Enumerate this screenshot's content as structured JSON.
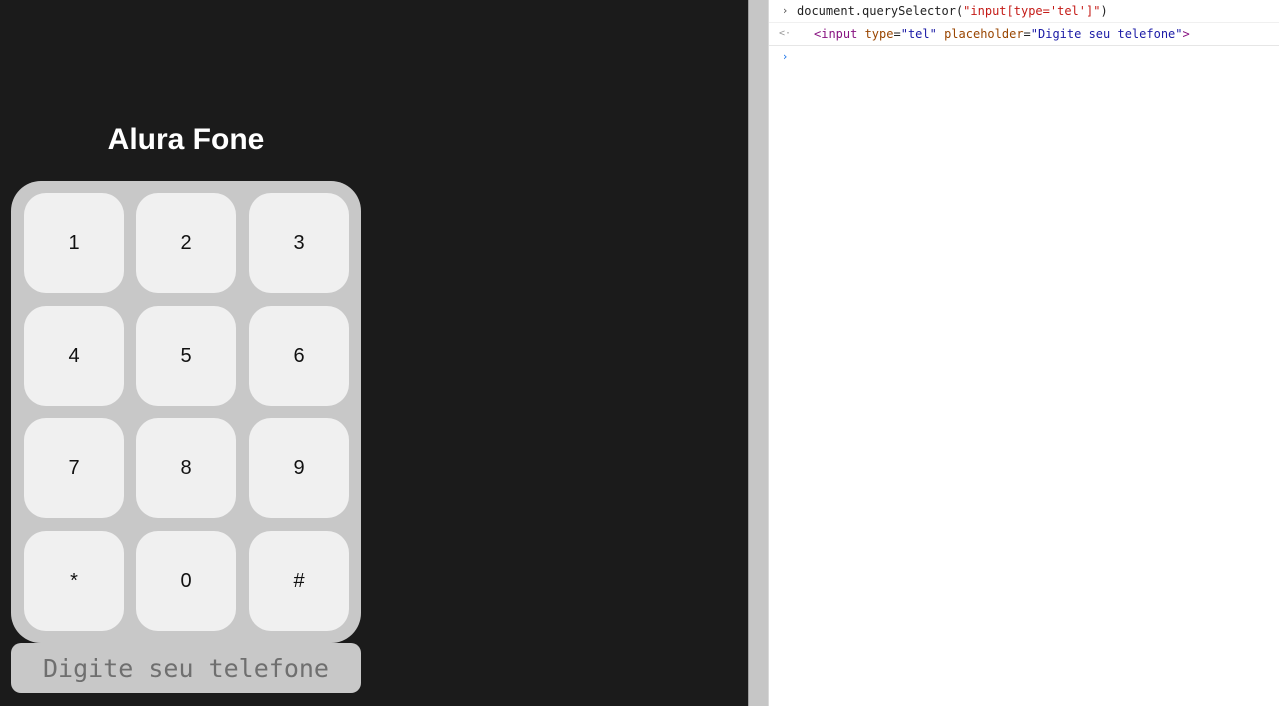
{
  "app": {
    "title": "Alura Fone",
    "keys": [
      {
        "label": "1"
      },
      {
        "label": "2"
      },
      {
        "label": "3"
      },
      {
        "label": "4"
      },
      {
        "label": "5"
      },
      {
        "label": "6"
      },
      {
        "label": "7"
      },
      {
        "label": "8"
      },
      {
        "label": "9"
      },
      {
        "label": "*"
      },
      {
        "label": "0"
      },
      {
        "label": "#"
      }
    ],
    "input": {
      "value": "",
      "placeholder": "Digite seu telefone"
    }
  },
  "console": {
    "command": {
      "prefix": "document.querySelector(",
      "arg": "\"input[type='tel']\"",
      "suffix": ")"
    },
    "result": {
      "open": "<input",
      "attr1_name": " type",
      "eq1": "=",
      "attr1_value": "\"tel\"",
      "attr2_name": " placeholder",
      "eq2": "=",
      "attr2_value": "\"Digite seu telefone\"",
      "close": ">"
    },
    "prompt_icon": "›",
    "return_icon": "<·"
  },
  "colors": {
    "page_background": "#1b1b1b",
    "keypad_background": "#c8c8c8",
    "key_background": "#f0f0f0",
    "title_color": "#ffffff",
    "string_color": "#c41a16",
    "tag_color": "#881280",
    "attr_color": "#994500",
    "attr_value_color": "#1a1aa6",
    "prompt_active_color": "#1a73e8"
  }
}
